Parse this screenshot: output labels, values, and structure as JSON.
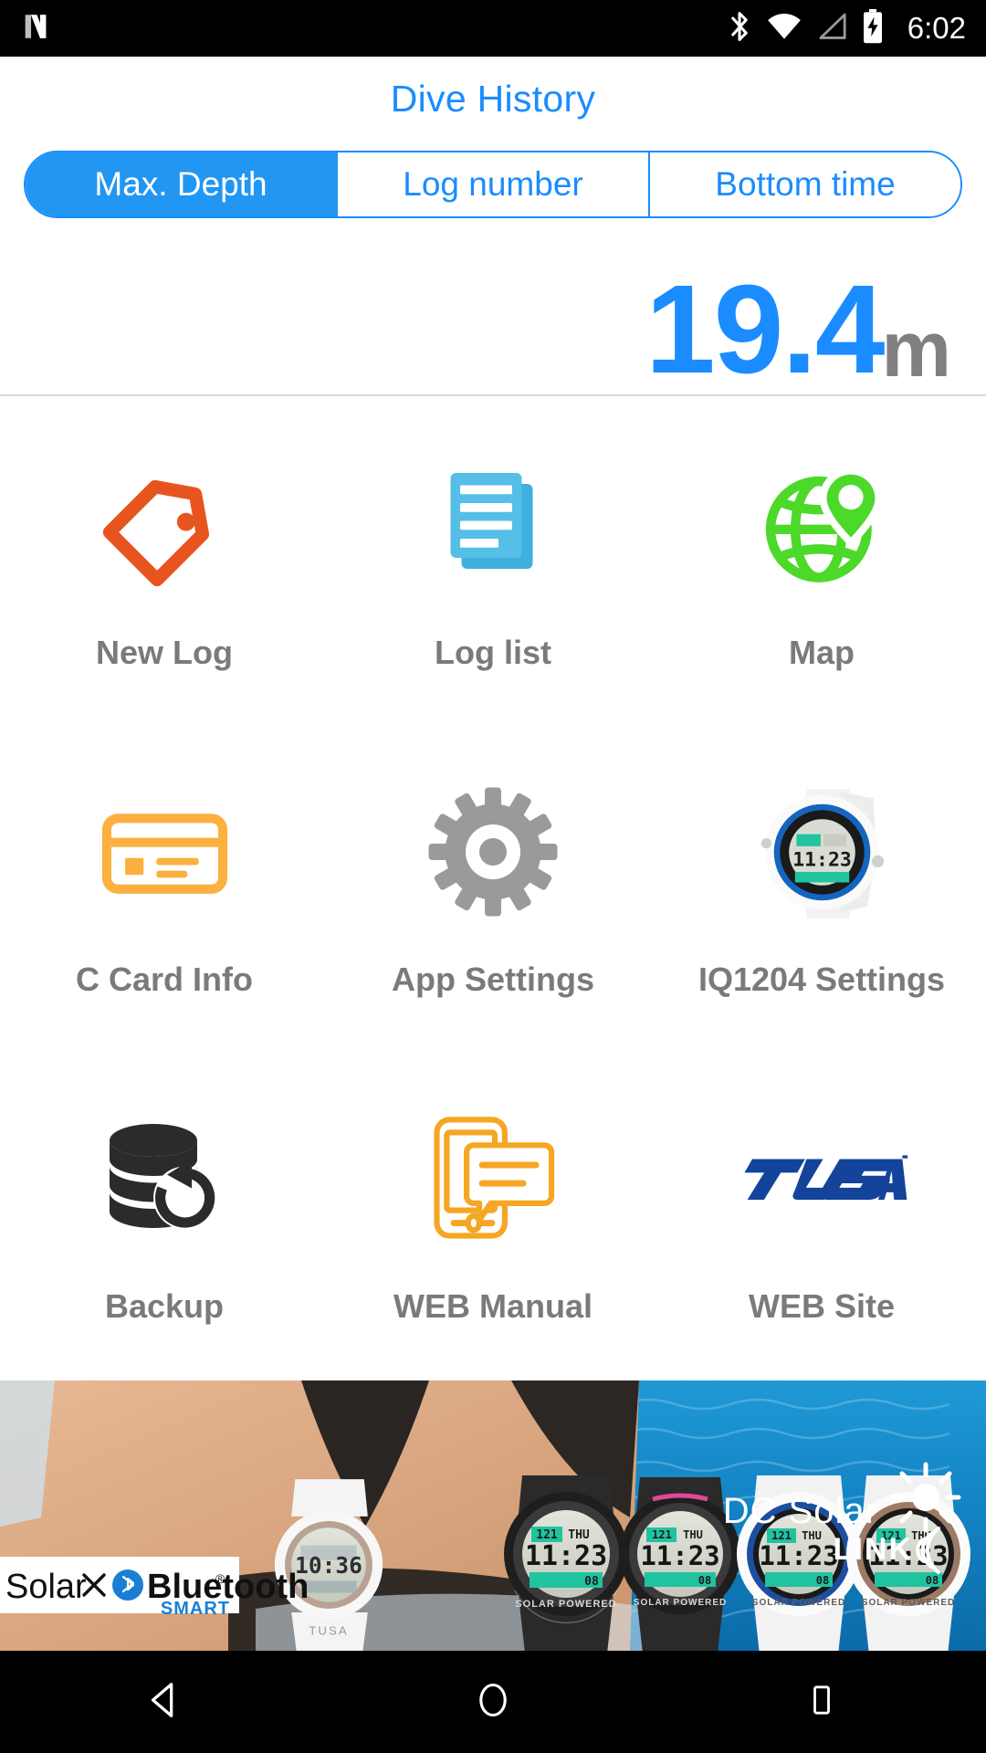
{
  "status_bar": {
    "notification_icon": "android-n-logo-icon",
    "icons": [
      "bluetooth-icon",
      "wifi-icon",
      "cellular-signal-icon",
      "battery-charging-icon"
    ],
    "time": "6:02"
  },
  "header": {
    "title": "Dive History"
  },
  "segmented_control": {
    "options": [
      {
        "label": "Max. Depth",
        "selected": true
      },
      {
        "label": "Log number",
        "selected": false
      },
      {
        "label": "Bottom time",
        "selected": false
      }
    ],
    "active_color": "#2196f3",
    "text_color": "#1a8cff"
  },
  "stat": {
    "value": "19.4",
    "unit": "m",
    "value_color": "#1a8cff",
    "unit_color": "#808080"
  },
  "menu": {
    "items": [
      {
        "label": "New Log",
        "icon": "tag-icon",
        "color": "#e8541f"
      },
      {
        "label": "Log list",
        "icon": "documents-icon",
        "color": "#4cb8e0"
      },
      {
        "label": "Map",
        "icon": "globe-pin-icon",
        "color": "#4cd929"
      },
      {
        "label": "C Card Info",
        "icon": "credit-card-icon",
        "color": "#fbb040"
      },
      {
        "label": "App Settings",
        "icon": "gear-icon",
        "color": "#9a9a9a"
      },
      {
        "label": "IQ1204 Settings",
        "icon": "dive-watch-icon",
        "color": "#1565c0"
      },
      {
        "label": "Backup",
        "icon": "database-restore-icon",
        "color": "#2b2b2b"
      },
      {
        "label": "WEB Manual",
        "icon": "phone-chat-icon",
        "color": "#f5a623"
      },
      {
        "label": "WEB Site",
        "icon": "tusa-logo-icon",
        "color": "#14439c"
      }
    ],
    "label_color": "#7a7a7a"
  },
  "banner": {
    "badge_solar": "Solar",
    "badge_x": "×",
    "badge_bluetooth": "Bluetooth",
    "badge_registered": "®",
    "badge_smart": "SMART",
    "brand_line1": "DC Solar",
    "brand_line2": "LINK",
    "watch_display_date": "THU",
    "watch_display_channel": "121",
    "watch_display_time": "11:23",
    "watch_display_sub": "08",
    "watch_text_solar": "SOLAR POWERED",
    "white_watch_time": "10:36",
    "water_color": "#1384c4",
    "brand_text_color": "#ffffff"
  },
  "nav_bar": {
    "buttons": [
      {
        "name": "back-button",
        "icon": "triangle-left-icon"
      },
      {
        "name": "home-button",
        "icon": "circle-icon"
      },
      {
        "name": "recents-button",
        "icon": "square-icon"
      }
    ]
  }
}
